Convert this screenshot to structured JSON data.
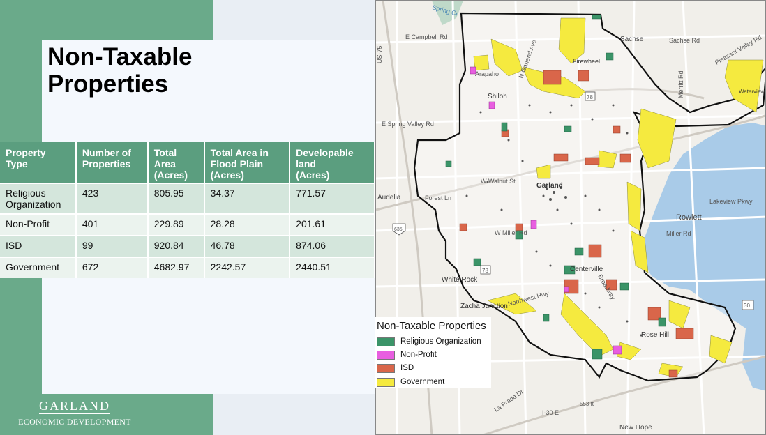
{
  "title_line1": "Non-Taxable",
  "title_line2": "Properties",
  "table": {
    "headers": [
      [
        "Property",
        "Type"
      ],
      [
        "Number of",
        "Properties"
      ],
      [
        "Total",
        "Area",
        "(Acres)"
      ],
      [
        "Total Area in",
        "Flood Plain",
        "(Acres)"
      ],
      [
        "Developable",
        "land",
        "(Acres)"
      ]
    ],
    "rows": [
      [
        "Religious Organization",
        "423",
        "805.95",
        "34.37",
        "771.57"
      ],
      [
        "Non-Profit",
        "401",
        "229.89",
        "28.28",
        "201.61"
      ],
      [
        "ISD",
        "99",
        "920.84",
        "46.78",
        "874.06"
      ],
      [
        "Government",
        "672",
        "4682.97",
        "2242.57",
        "2440.51"
      ]
    ]
  },
  "logo": {
    "name": "GARLAND",
    "subtitle": "ECONOMIC DEVELOPMENT"
  },
  "map": {
    "labels": {
      "campbell": "E Campbell Rd",
      "sachse": "Sachse",
      "sachse_rd": "Sachse Rd",
      "pleasant_valley": "Pleasant Valley Rd",
      "us75": "US-75",
      "arapaho": "Arapaho",
      "shiloh": "Shiloh",
      "spring_valley": "E Spring Valley Rd",
      "merritt": "Merritt Rd",
      "waterview": "Waterview Club",
      "walnut": "W Walnut St",
      "garland": "Garland",
      "forest": "Forest Ln",
      "audelia": "Audelia",
      "rowlett": "Rowlett",
      "lakeview": "Lakeview Pkwy",
      "miller": "Miller Rd",
      "wmiller": "W Miller Rd",
      "centerville": "Centerville",
      "white_rock": "White Rock",
      "zacha": "Zacha Junction",
      "rose_hill": "Rose Hill",
      "new_hope": "New Hope",
      "i30": "I-30 E",
      "r78a": "78",
      "r78b": "78",
      "r635": "635",
      "r30": "30",
      "r553": "553 ft",
      "spring_creek": "Spring Cr",
      "n_garland": "N Garland Ave",
      "firewheel": "Firewheel",
      "broadway": "Broadway",
      "northwest_hwy": "Northwest Hwy",
      "la_prada": "La Prada Dr"
    }
  },
  "legend": {
    "title": "Non-Taxable Properties",
    "items": [
      {
        "label": "Religious Organization",
        "color": "#3b9468"
      },
      {
        "label": "Non-Profit",
        "color": "#e85ee0"
      },
      {
        "label": "ISD",
        "color": "#d9664a"
      },
      {
        "label": "Government",
        "color": "#f5ea3f"
      }
    ]
  },
  "colors": {
    "accent_green": "#6aaa8a",
    "header_green": "#5b9e7f",
    "water": "#a9cbe8",
    "boundary": "#111111"
  }
}
